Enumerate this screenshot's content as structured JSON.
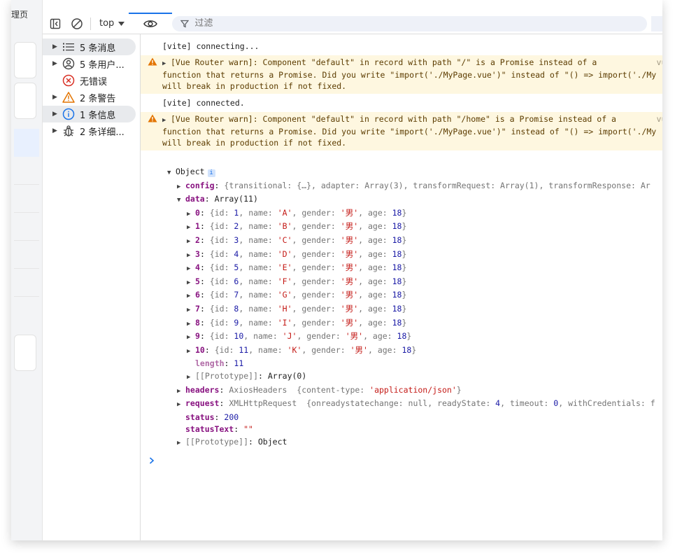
{
  "page": {
    "crumb": "理页"
  },
  "toolbar": {
    "context": "top",
    "filter_placeholder": "过滤"
  },
  "sidebar": {
    "items": [
      {
        "label": "5 条消息",
        "icon": "list-icon"
      },
      {
        "label": "5 条用户...",
        "icon": "user-icon"
      },
      {
        "label": "无错误",
        "icon": "error-icon"
      },
      {
        "label": "2 条警告",
        "icon": "warning-icon"
      },
      {
        "label": "1 条信息",
        "icon": "info-icon"
      },
      {
        "label": "2 条详细...",
        "icon": "bug-icon"
      }
    ]
  },
  "console": {
    "msg1": "[vite] connecting...",
    "warn1": {
      "line1": "[Vue Router warn]: Component \"default\" in record with path \"/\" is a Promise instead of a",
      "line2": "function that returns a Promise. Did you write \"import('./MyPage.vue')\" instead of \"() => import('./My",
      "line3": "will break in production if not fixed.",
      "source": "vue-rou"
    },
    "msg2": "[vite] connected.",
    "warn2": {
      "line1": "[Vue Router warn]: Component \"default\" in record with path \"/home\" is a Promise instead of a",
      "line2": "function that returns a Promise. Did you write \"import('./MyPage.vue')\" instead of \"() => import('./My",
      "line3": "will break in production if not fixed.",
      "source": "vue-rou"
    },
    "object": {
      "label": "Object",
      "config": "{transitional: {…}, adapter: Array(3), transformRequest: Array(1), transformResponse: Ar",
      "data_label": "Array(11)",
      "rows": [
        {
          "idx": "0",
          "id": "1",
          "name": "'A'",
          "gender": "'男'",
          "age": "18"
        },
        {
          "idx": "1",
          "id": "2",
          "name": "'B'",
          "gender": "'男'",
          "age": "18"
        },
        {
          "idx": "2",
          "id": "3",
          "name": "'C'",
          "gender": "'男'",
          "age": "18"
        },
        {
          "idx": "3",
          "id": "4",
          "name": "'D'",
          "gender": "'男'",
          "age": "18"
        },
        {
          "idx": "4",
          "id": "5",
          "name": "'E'",
          "gender": "'男'",
          "age": "18"
        },
        {
          "idx": "5",
          "id": "6",
          "name": "'F'",
          "gender": "'男'",
          "age": "18"
        },
        {
          "idx": "6",
          "id": "7",
          "name": "'G'",
          "gender": "'男'",
          "age": "18"
        },
        {
          "idx": "7",
          "id": "8",
          "name": "'H'",
          "gender": "'男'",
          "age": "18"
        },
        {
          "idx": "8",
          "id": "9",
          "name": "'I'",
          "gender": "'男'",
          "age": "18"
        },
        {
          "idx": "9",
          "id": "10",
          "name": "'J'",
          "gender": "'男'",
          "age": "18"
        },
        {
          "idx": "10",
          "id": "11",
          "name": "'K'",
          "gender": "'男'",
          "age": "18"
        }
      ],
      "length": "11",
      "data_proto": "Array(0)",
      "headers_type": "AxiosHeaders",
      "headers_content_type": "'application/json'",
      "request_type": "XMLHttpRequest",
      "request_null": "null",
      "request_ready_state": "4",
      "request_timeout": "0",
      "status": "200",
      "status_text": "\"\"",
      "proto": "Object"
    }
  }
}
